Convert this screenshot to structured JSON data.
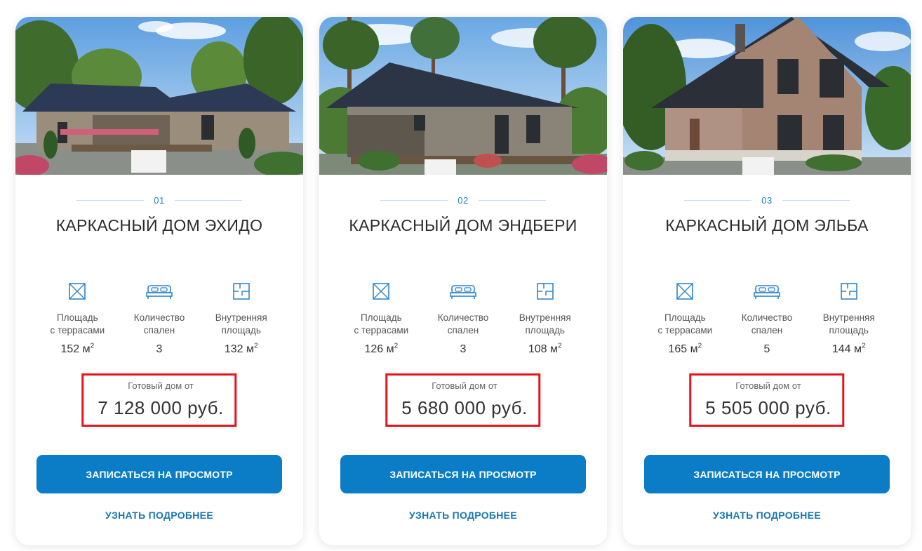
{
  "colors": {
    "accent": "#0a7dc6",
    "link": "#1676b3",
    "number": "#1a7fc1",
    "highlight_border": "#e3141b"
  },
  "cards": [
    {
      "number": "01",
      "title": "КАРКАСНЫЙ ДОМ ЭХИДО",
      "stats": [
        {
          "icon": "area-icon",
          "label_line1": "Площадь",
          "label_line2": "с террасами",
          "value": "152 м",
          "unit_sup": "2"
        },
        {
          "icon": "bed-icon",
          "label_line1": "Количество",
          "label_line2": "спален",
          "value": "3",
          "unit_sup": ""
        },
        {
          "icon": "floorplan-icon",
          "label_line1": "Внутренняя",
          "label_line2": "площадь",
          "value": "132 м",
          "unit_sup": "2"
        }
      ],
      "price_label": "Готовый дом от",
      "price": "7 128 000 руб.",
      "button_label": "ЗАПИСАТЬСЯ НА ПРОСМОТР",
      "link_label": "УЗНАТЬ ПОДРОБНЕЕ"
    },
    {
      "number": "02",
      "title": "КАРКАСНЫЙ ДОМ ЭНДБЕРИ",
      "stats": [
        {
          "icon": "area-icon",
          "label_line1": "Площадь",
          "label_line2": "с террасами",
          "value": "126 м",
          "unit_sup": "2"
        },
        {
          "icon": "bed-icon",
          "label_line1": "Количество",
          "label_line2": "спален",
          "value": "3",
          "unit_sup": ""
        },
        {
          "icon": "floorplan-icon",
          "label_line1": "Внутренняя",
          "label_line2": "площадь",
          "value": "108 м",
          "unit_sup": "2"
        }
      ],
      "price_label": "Готовый дом от",
      "price": "5 680 000 руб.",
      "button_label": "ЗАПИСАТЬСЯ НА ПРОСМОТР",
      "link_label": "УЗНАТЬ ПОДРОБНЕЕ"
    },
    {
      "number": "03",
      "title": "КАРКАСНЫЙ ДОМ ЭЛЬБА",
      "stats": [
        {
          "icon": "area-icon",
          "label_line1": "Площадь",
          "label_line2": "с террасами",
          "value": "165 м",
          "unit_sup": "2"
        },
        {
          "icon": "bed-icon",
          "label_line1": "Количество",
          "label_line2": "спален",
          "value": "5",
          "unit_sup": ""
        },
        {
          "icon": "floorplan-icon",
          "label_line1": "Внутренняя",
          "label_line2": "площадь",
          "value": "144 м",
          "unit_sup": "2"
        }
      ],
      "price_label": "Готовый дом от",
      "price": "5 505 000 руб.",
      "button_label": "ЗАПИСАТЬСЯ НА ПРОСМОТР",
      "link_label": "УЗНАТЬ ПОДРОБНЕЕ"
    }
  ]
}
